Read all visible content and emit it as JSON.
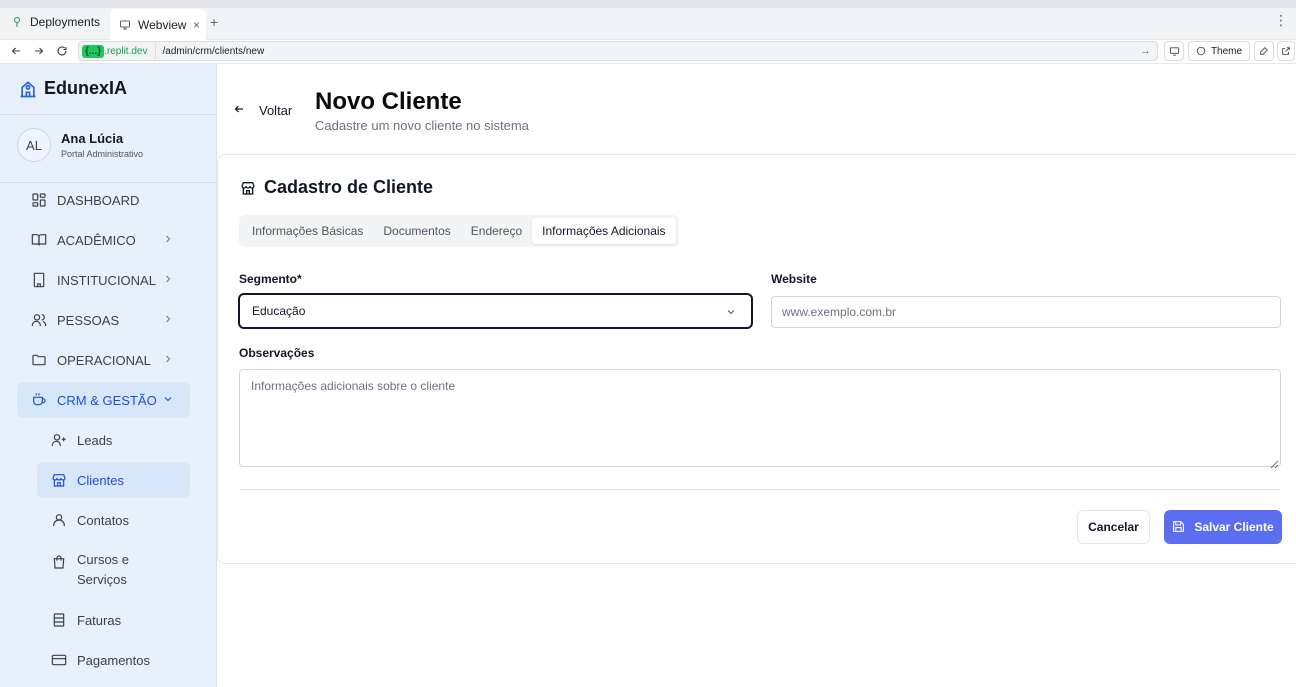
{
  "browser": {
    "tabs": [
      {
        "label": "Deployments",
        "icon": "deployments-icon"
      },
      {
        "label": "Webview",
        "icon": "monitor-icon",
        "close": "×"
      }
    ],
    "new_tab": "+",
    "menu": "⋮",
    "url_host_badge": "{...}",
    "url_host": ".replit.dev",
    "url_path": "/admin/crm/clients/new",
    "theme_label": "Theme"
  },
  "sidebar": {
    "brand": "EdunexIA",
    "user": {
      "initials": "AL",
      "name": "Ana Lúcia",
      "role": "Portal Administrativo"
    },
    "items": [
      {
        "label": "DASHBOARD"
      },
      {
        "label": "ACADÊMICO"
      },
      {
        "label": "INSTITUCIONAL"
      },
      {
        "label": "PESSOAS"
      },
      {
        "label": "OPERACIONAL"
      },
      {
        "label": "CRM & GESTÃO"
      }
    ],
    "subitems": [
      {
        "label": "Leads"
      },
      {
        "label": "Clientes"
      },
      {
        "label": "Contatos"
      },
      {
        "label": "Cursos e Serviços"
      },
      {
        "label": "Faturas"
      },
      {
        "label": "Pagamentos"
      }
    ]
  },
  "header": {
    "back_label": "Voltar",
    "title": "Novo Cliente",
    "subtitle": "Cadastre um novo cliente no sistema"
  },
  "card": {
    "title": "Cadastro de Cliente",
    "tabs": [
      "Informações Básicas",
      "Documentos",
      "Endereço",
      "Informações Adicionais"
    ],
    "active_tab": "Informações Adicionais",
    "segment_label": "Segmento*",
    "segment_value": "Educação",
    "website_label": "Website",
    "website_placeholder": "www.exemplo.com.br",
    "notes_label": "Observações",
    "notes_placeholder": "Informações adicionais sobre o cliente",
    "cancel_label": "Cancelar",
    "save_label": "Salvar Cliente"
  },
  "colors": {
    "accent": "#5b6ef0",
    "sidebar_bg": "#e8f1fb",
    "active_nav": "#1d4ed8"
  }
}
